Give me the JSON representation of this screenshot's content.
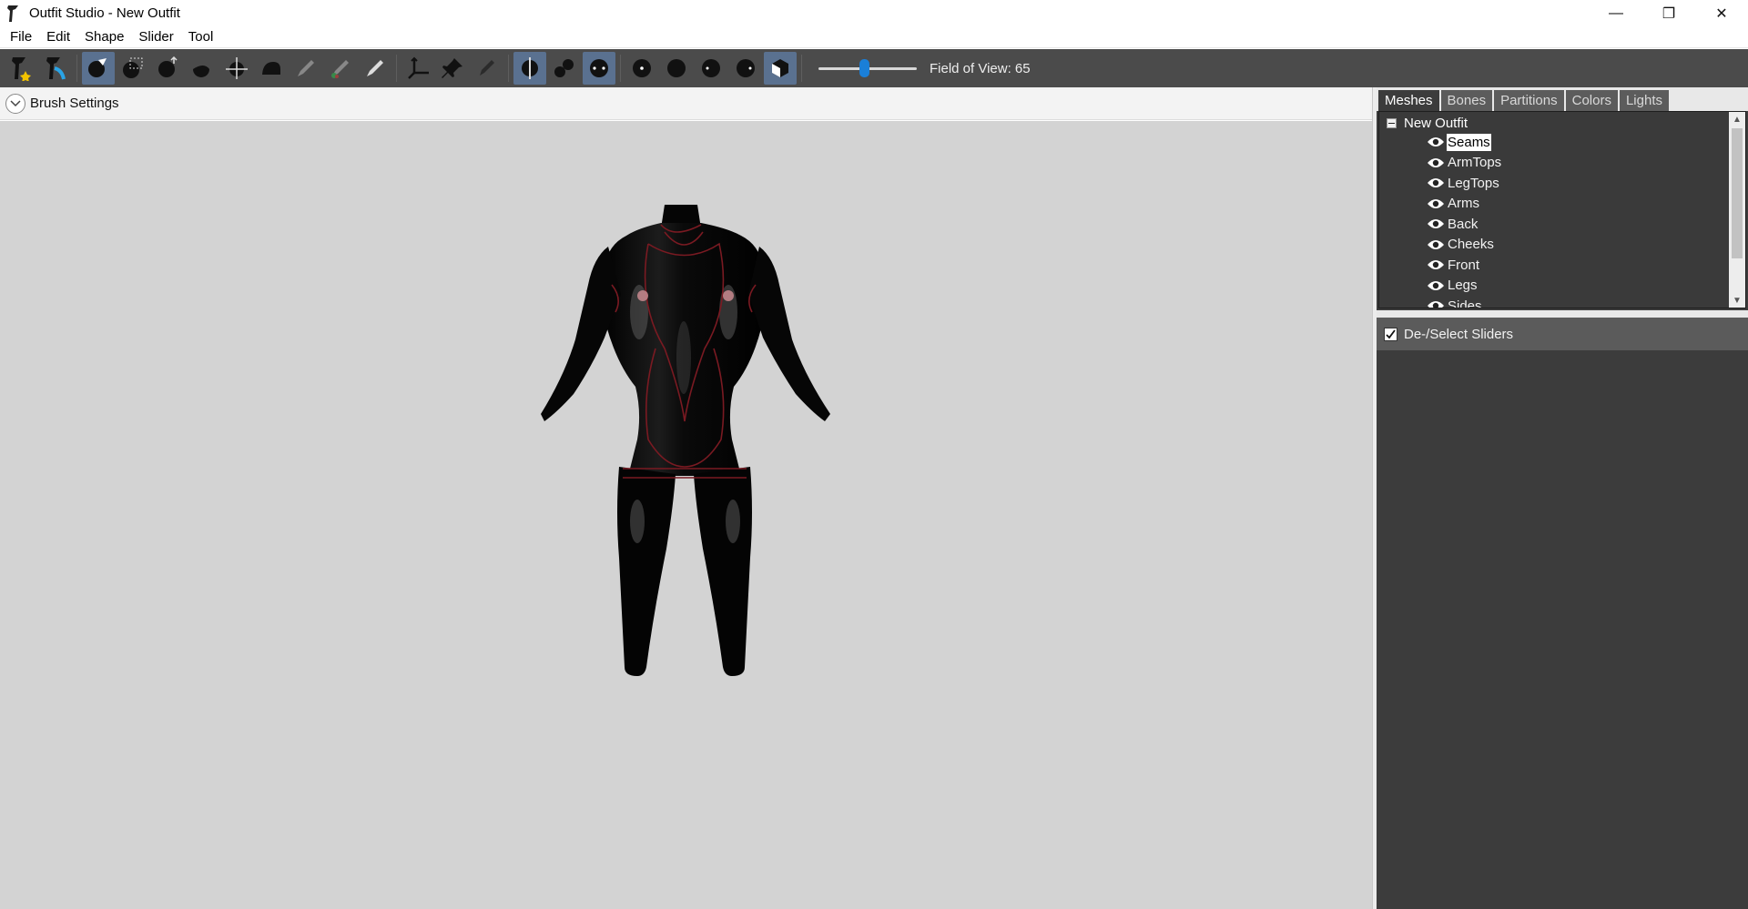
{
  "window": {
    "title": "Outfit Studio - New Outfit",
    "controls": {
      "minimize": "—",
      "restore": "❐",
      "close": "✕"
    }
  },
  "menu": [
    "File",
    "Edit",
    "Shape",
    "Slider",
    "Tool"
  ],
  "toolbar": {
    "fov_label": "Field of View: 65",
    "fov_value": 65,
    "fov_slider_fraction": 0.46
  },
  "brush_settings": {
    "label": "Brush Settings"
  },
  "tabs": [
    "Meshes",
    "Bones",
    "Partitions",
    "Colors",
    "Lights"
  ],
  "active_tab": "Meshes",
  "mesh_tree": {
    "root": "New Outfit",
    "items": [
      "Seams",
      "ArmTops",
      "LegTops",
      "Arms",
      "Back",
      "Cheeks",
      "Front",
      "Legs",
      "Sides"
    ],
    "selected": "Seams"
  },
  "sliders": {
    "header": "De-/Select Sliders",
    "checked": true
  },
  "colors": {
    "toolbar_bg": "#4b4b4b",
    "active_tool": "#5a7190",
    "viewport_bg": "#d3d3d3",
    "panel_bg": "#3c3c3c",
    "slider_accent": "#1a7fd8",
    "seam_lines": "#7a1a22"
  }
}
